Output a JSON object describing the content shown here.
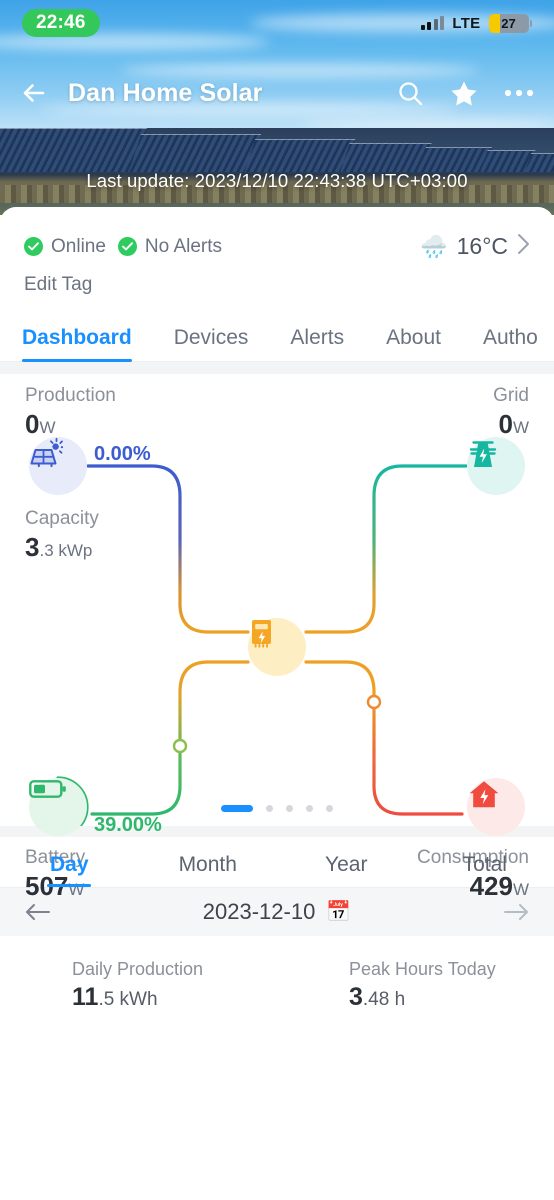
{
  "status_bar": {
    "time": "22:46",
    "network": "LTE",
    "battery_percent": "27",
    "signal_icon": "signal-bars-icon",
    "battery_icon": "battery-low-power-icon"
  },
  "header": {
    "back_icon": "back-arrow-icon",
    "title": "Dan Home Solar",
    "search_icon": "search-icon",
    "favorite_icon": "star-icon",
    "more_icon": "more-options-icon",
    "last_update": "Last update: 2023/12/10 22:43:38 UTC+03:00"
  },
  "status_card": {
    "online_label": "Online",
    "alerts_label": "No Alerts",
    "check_icon": "check-circle-icon",
    "weather_icon": "rain-cloud-icon",
    "temperature": "16°C",
    "chevron_icon": "chevron-right-icon",
    "edit_tag_label": "Edit Tag"
  },
  "tabs": [
    {
      "label": "Dashboard",
      "active": true
    },
    {
      "label": "Devices",
      "active": false
    },
    {
      "label": "Alerts",
      "active": false
    },
    {
      "label": "About",
      "active": false
    },
    {
      "label": "Autho",
      "active": false
    }
  ],
  "flow": {
    "production": {
      "label": "Production",
      "value": "0",
      "unit": "W",
      "percent": "0.00%",
      "icon": "solar-panel-icon",
      "color": "#3c5ccf"
    },
    "capacity": {
      "label": "Capacity",
      "value": "3",
      "value_suffix": ".3 kWp"
    },
    "grid": {
      "label": "Grid",
      "value": "0",
      "unit": "W",
      "icon": "grid-tower-icon",
      "color": "#16b7a0"
    },
    "inverter": {
      "icon": "inverter-icon",
      "color": "#f5a623"
    },
    "battery": {
      "label": "Battery",
      "value": "507",
      "unit": "W",
      "percent": "39.00%",
      "icon": "battery-icon",
      "color": "#2fb86c"
    },
    "consumption": {
      "label": "Consumption",
      "value": "429",
      "unit": "W",
      "icon": "home-consumption-icon",
      "color": "#ef4b3e"
    },
    "pagination": {
      "total": 5,
      "active_index": 0
    }
  },
  "period_tabs": [
    {
      "label": "Day",
      "active": true
    },
    {
      "label": "Month",
      "active": false
    },
    {
      "label": "Year",
      "active": false
    },
    {
      "label": "Total",
      "active": false
    }
  ],
  "date_nav": {
    "prev_icon": "arrow-left-icon",
    "date": "2023-12-10",
    "calendar_icon": "calendar-icon",
    "next_icon": "arrow-right-icon"
  },
  "daily_stats": [
    {
      "label": "Daily Production",
      "value": "11",
      "value_suffix": ".5 kWh"
    },
    {
      "label": "Peak Hours Today",
      "value": "3",
      "value_suffix": ".48 h"
    }
  ]
}
